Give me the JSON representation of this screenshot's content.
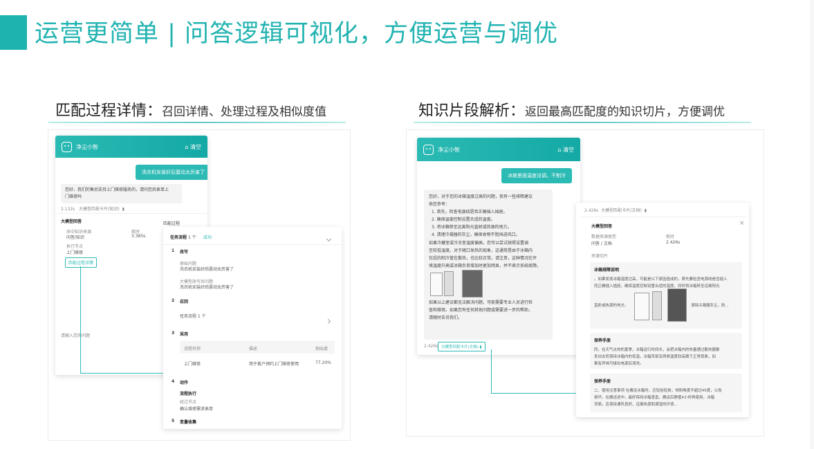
{
  "title": "运营更简单 | 问答逻辑可视化，方便运营与调优",
  "left": {
    "heading": "匹配过程详情",
    "heading_sep": "：",
    "subheading": "召回详情、处理过程及相似度值",
    "chat": {
      "bot_name": "净尘小智",
      "clear": "清空",
      "user_msg": "洗衣机安装好后震动太厉害了",
      "answer_line1": "您好，我们的售后支持上门维修服务的，请问您后表单上",
      "answer_line2": "门维修吗",
      "meta_score": "2.132s",
      "meta_source": "大模型匹配卡片(知识)",
      "input_placeholder": "请输入您的问题"
    },
    "detail": {
      "title": "大模型回答",
      "col1": "命中知识来源",
      "col2": "耗时",
      "val1": "问答/知识",
      "val2": "3.385s",
      "row2_label": "执行节点",
      "row2_val": "上门维修",
      "link": "匹配过程详情"
    },
    "process": {
      "label": "匹配过程",
      "task_label": "任务流程",
      "task_count": "1 个",
      "success": "成功",
      "steps": [
        {
          "n": "1",
          "name": "改写"
        },
        {
          "n": "2",
          "name": "召回"
        },
        {
          "n": "3",
          "name": "采用"
        },
        {
          "n": "4",
          "name": "动作"
        },
        {
          "n": "5",
          "name": "变量收集"
        }
      ],
      "rewrite_orig_label": "原始问题",
      "rewrite_orig": "洗衣机安装好后震动太厉害了",
      "rewrite_new_label": "大模型改写后问题",
      "rewrite_new": "洗衣机安装好后震动太厉害了",
      "recall_row": "任务流程   1 个",
      "table_headers": [
        "流程名称",
        "描述",
        "相似度"
      ],
      "table_row": [
        "上门维修",
        "用于客户预约上门维修使用",
        "77.20%"
      ],
      "action_title": "流程执行",
      "action_sub": "经过节点",
      "action_val": "确认维修需求表单"
    }
  },
  "right": {
    "heading": "知识片段解析",
    "heading_sep": "：",
    "subheading": "返回最高匹配度的知识切片，方便调优",
    "chat": {
      "bot_name": "净尘小智",
      "clear": "清空",
      "user_msg": "冰箱里面温度没调，不制冷",
      "answer_intro1": "您好，对于您的冰箱温度过高的问题，我有一些排障建议",
      "answer_intro2": "供您参考：",
      "steps": [
        "1. 首先，检查电源线是否正确插入插座。",
        "2. 确保温度控制设置合适的温度。",
        "3. 将冰箱移至远离阳光直射或热源的地方。",
        "4. 清理冷凝器的灰尘，确保食物不阻挡进风口。"
      ],
      "para1": [
        "如果冷藏室或冷冻室温度偏高，您可以尝试按照设置调",
        "至较低温度。对于随口发热的现象，这通常是由于冰箱内",
        "包括的制冷管在散热，也比较正常。请注意，这种情况在环",
        "境温度升高或冰箱负荷增加时更加明显，并不表示系统故障。"
      ],
      "para2": [
        "如果以上建议都无法解决问题，可能需要专业人员进行检",
        "查和维修。如果您有任何其他问题或需要进一步的帮助，",
        "请随时告诉我们。"
      ],
      "meta_score": "2.426s",
      "meta_source": "大模型匹配卡片(文档)"
    },
    "detail": {
      "meta_score": "2.426s",
      "meta_source": "大模型匹配卡片(文档)",
      "title": "大模型回答",
      "col1": "数据来源类型",
      "col2": "耗时",
      "val1": "问答 / 文档",
      "val2": "2.426s",
      "source_label": "来源切片",
      "cards": [
        {
          "title": "冰箱排障说明",
          "text1": "。如果发现冰箱温度过高，可能是以下原因造成的，首先要检查电源线是否插入",
          "text2": "而正确插入插座，确保温度控制设置合适的温度，同时将冰箱移至远离阳光",
          "text3": "直射或热源的地方。",
          "text4": "清除冷凝器灰尘，防..."
        },
        {
          "title": "保养手册",
          "text1": "同，在天气炎热的夏季，冰箱运行时间长，会把冰箱内的热量通过散热器散",
          "text2": "发出去而保持冰箱内的低温，冰箱背部及两侧温度较高属于正常现象，如",
          "text3": "果有异味可拔出电源后清洗。"
        },
        {
          "title": "保养手册",
          "text1": "二、使用注意事项 在搬运冰箱时，应轻抬轻放，倾斜角度不超过45度，以免",
          "text2": "损坏。在搬运途中，最好保持冰箱竖直，搬运后静置4小时再使用，冰箱",
          "text3": "背面，应保持通风良好，远离热源和潮湿的环境..."
        }
      ]
    }
  },
  "colors": {
    "accent": "#1fb3b0",
    "header": "#2bbab4"
  },
  "icons": [
    "bot-icon",
    "trash-icon",
    "close-icon",
    "chevron-right-icon",
    "chevron-down-icon",
    "fridge-image"
  ]
}
